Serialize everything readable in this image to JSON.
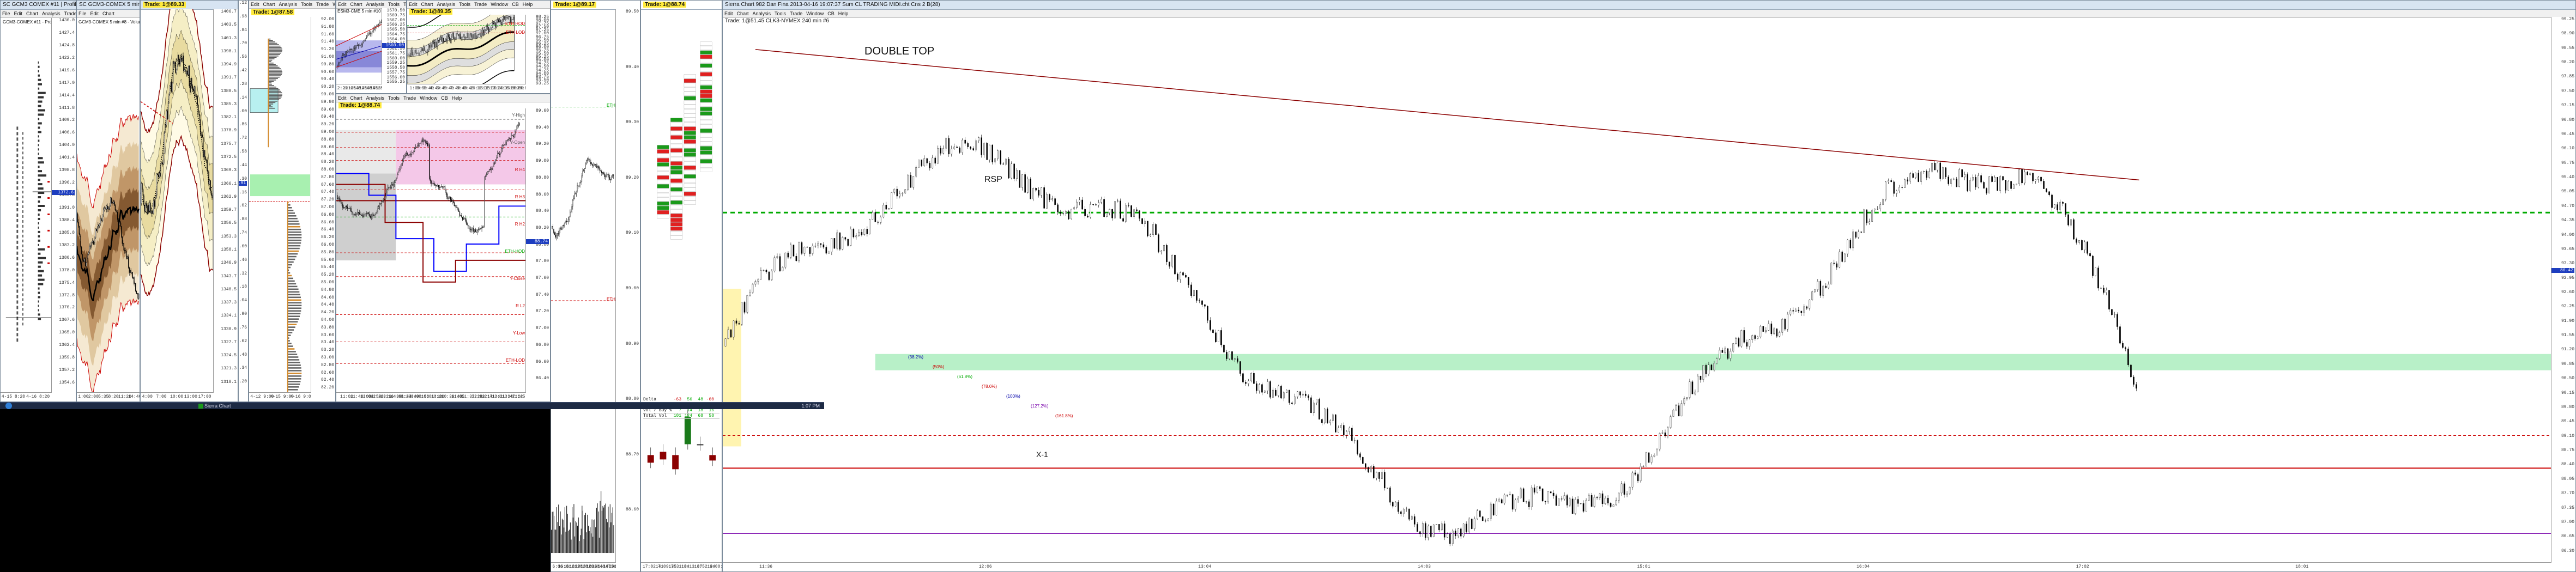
{
  "taskbar": {
    "task": "Sierra Chart",
    "clock": "1:07 PM"
  },
  "windows": {
    "w1": {
      "title": "SC GCM3 COMEX #11 | Profile Period: 1 Days, TPOs: 0.3 x 30 #",
      "menu": [
        "File",
        "Edit",
        "Chart",
        "Analysis",
        "Trade",
        "Window",
        "CB",
        "Help"
      ],
      "inner_title": "GCM3-COMEX  #11 - Profile Period: 1 Days",
      "axis": [
        "1430.0",
        "1427.4",
        "1424.8",
        "1422.2",
        "1419.6",
        "1417.0",
        "1414.4",
        "1411.8",
        "1409.2",
        "1406.6",
        "1404.0",
        "1401.4",
        "1398.8",
        "1396.2",
        "1393.6",
        "1391.0",
        "1388.4",
        "1385.8",
        "1383.2",
        "1380.6",
        "1378.0",
        "1375.4",
        "1372.8",
        "1370.2",
        "1367.6",
        "1365.0",
        "1362.4",
        "1359.8",
        "1357.2",
        "1354.6"
      ],
      "bottom": [
        "4-15  8:20",
        "4-16  8:20"
      ],
      "last": "1372.6"
    },
    "w2": {
      "title": "SC GCM3-COMEX  5 min  #8  COMEX Gol...",
      "inner_title": "GCM3-COMEX  5 min  #8 - Volume Weighted Avg...",
      "bottom": [
        "1:00",
        "2:00",
        "5:35",
        "8:20",
        "11:20",
        "14:40"
      ]
    },
    "w3": {
      "trade": "Trade: 1@89.33",
      "axis": [
        "1406.7",
        "1403.5",
        "1401.3",
        "1398.1",
        "1394.9",
        "1391.7",
        "1388.5",
        "1385.3",
        "1382.1",
        "1378.9",
        "1375.7",
        "1372.5",
        "1369.3",
        "1366.1",
        "1362.9",
        "1359.7",
        "1356.5",
        "1353.3",
        "1350.1",
        "1346.9",
        "1343.7",
        "1340.5",
        "1337.3",
        "1334.1",
        "1330.9",
        "1327.7",
        "1324.5",
        "1321.3",
        "1318.1"
      ],
      "bottom": [
        "4:00",
        "7:00",
        "10:00",
        "13:00",
        "17:00"
      ]
    },
    "w4": {
      "axis": [
        "90.12",
        "89.98",
        "89.84",
        "89.70",
        "89.56",
        "89.42",
        "89.28",
        "89.14",
        "89.00",
        "88.86",
        "88.72",
        "88.58",
        "88.44",
        "88.30",
        "88.16",
        "88.02",
        "87.88",
        "87.74",
        "87.60",
        "87.46",
        "87.32",
        "87.18",
        "87.04",
        "86.90",
        "86.76",
        "86.62",
        "86.48",
        "86.34",
        "86.20"
      ],
      "bottom": [
        "4-16  6:00",
        "12:00",
        "18:00",
        "0:00",
        "6:00",
        "12:00",
        "15:30",
        "19:30"
      ],
      "last": "86.91"
    },
    "w5": {
      "menu": [
        "Edit",
        "Chart",
        "Analysis",
        "Tools",
        "Trade",
        "Window",
        "CB",
        "Help"
      ],
      "trade": "Trade: 1@87.58",
      "axis": [
        "92.00",
        "91.80",
        "91.60",
        "91.40",
        "91.20",
        "91.00",
        "90.80",
        "90.60",
        "90.40",
        "90.20",
        "90.00",
        "89.80",
        "89.60",
        "89.40",
        "89.20",
        "89.00",
        "88.80",
        "88.60",
        "88.40",
        "88.20",
        "88.00",
        "87.80",
        "87.60",
        "87.40",
        "87.20",
        "87.00",
        "86.80",
        "86.60",
        "86.40",
        "86.20",
        "86.00",
        "85.80",
        "85.60",
        "85.40",
        "85.20",
        "85.00",
        "84.80",
        "84.60",
        "84.40",
        "84.20",
        "84.00",
        "83.80",
        "83.60",
        "83.40",
        "83.20",
        "83.00",
        "82.80",
        "82.60",
        "82.40",
        "82.20"
      ],
      "bottom": [
        "4-12  9:00",
        "4-15  9:00",
        "4-16  9:00"
      ]
    },
    "w6": {
      "menu": [
        "Edit",
        "Chart",
        "Analysis",
        "Tools",
        "Trade",
        "Window",
        "CB",
        "Help"
      ],
      "inner_title": "ESM3-CME  5 min  #10  TPO Value Area Lines - P...",
      "axis": [
        "1570.50",
        "1569.75",
        "1567.00",
        "1566.25",
        "1565.50",
        "1564.75",
        "1564.00",
        "1563.25",
        "1562.50",
        "1561.75",
        "1560.00",
        "1559.25",
        "1558.50",
        "1557.75",
        "1556.00",
        "1555.25"
      ],
      "last": "1560.00",
      "bottom": [
        "2:25",
        "12:05",
        "12:45",
        "13:25",
        "14:05",
        "14:45",
        "15:25",
        "16:05"
      ]
    },
    "w7": {
      "menu": [
        "Edit",
        "Chart",
        "Analysis",
        "Tools",
        "Trade",
        "Window",
        "CB",
        "Help"
      ],
      "trade": "Trade: 1@89.35",
      "axis": [
        "98.25",
        "98.00",
        "97.75",
        "97.50",
        "97.25",
        "97.00",
        "96.75",
        "96.50",
        "96.25",
        "96.00",
        "95.75",
        "95.50",
        "95.25",
        "95.00",
        "94.75",
        "94.50",
        "94.25",
        "94.00",
        "93.75",
        "93.50",
        "93.25"
      ],
      "labels": {
        "eth_hod": "ETH HOD",
        "eth_lod": "ETH LOD",
        "eth_vwap": "ETH VWAP"
      },
      "bottom": [
        "1:00",
        "3:00",
        "3:40",
        "4:40",
        "5:40",
        "6:40",
        "7:40",
        "8:40",
        "9:40",
        "10:15",
        "11:35",
        "12:35",
        "13:35",
        "14:35",
        "16:00",
        "18:00",
        "20:00"
      ]
    },
    "w8": {
      "menu": [
        "Edit",
        "Chart",
        "Analysis",
        "Tools",
        "Trade",
        "Window",
        "CB",
        "Help"
      ],
      "trade": "Trade: 1@88.74",
      "right_labels": [
        "Y-High",
        "Y-Open",
        "R H4",
        "R H3",
        "R H2",
        "ETH-HOD",
        "Y-Close",
        "R L2",
        "Y-Low",
        "ETH-LOD"
      ],
      "axis": [
        "89.60",
        "89.40",
        "89.20",
        "89.00",
        "88.80",
        "88.60",
        "88.40",
        "88.20",
        "88.00",
        "87.80",
        "87.60",
        "87.40",
        "87.20",
        "87.00",
        "86.80",
        "86.60",
        "86.40"
      ],
      "last": "88.74",
      "bottom": [
        "11:03",
        "11:40:08",
        "12:04:54",
        "12:28:29",
        "13:16:39",
        "14:01:44",
        "8:23:49",
        "9:08:53",
        "10:01:10",
        "10:20",
        "10:39:48",
        "11:05",
        "11:37:26",
        "12:03:17",
        "12:41:41",
        "13:21:34",
        "13:47:22",
        "11:45:03"
      ]
    },
    "w9": {
      "trade": "Trade: 1@89.17",
      "labels": {
        "eth_hod": "ETH HOD",
        "eth_lod": "ETH LOD"
      },
      "axis": [
        "89.50",
        "89.40",
        "89.30",
        "89.20",
        "89.10",
        "89.00",
        "88.90",
        "88.80",
        "88.70",
        "88.60"
      ],
      "bottom": [
        "6:06",
        "16:01",
        "16:11",
        "18:20",
        "18:28",
        "18:29",
        "16:30",
        "16:46",
        "16:47",
        "18:56",
        "19:01"
      ]
    },
    "w10": {
      "trade": "Trade: 1@88.74",
      "table_headers": [
        "Delta",
        "Cumulative",
        "Vol / Buy %",
        "Total Vol"
      ],
      "table_rows": [
        [
          "-63",
          "56",
          "48",
          "-60"
        ],
        [
          "1103",
          "1137",
          "1185",
          "1150"
        ],
        [
          "7",
          "14",
          "18",
          "16"
        ],
        [
          "101",
          "124",
          "68",
          "58"
        ]
      ],
      "bottom": [
        "17:02:41",
        "17:09:35",
        "17:31:34",
        "18:13:37",
        "18:52:34",
        "19:00:44"
      ]
    },
    "w11": {
      "title": "Sierra Chart 982 Dan Fina 2013-04-16  19:07:37  Sum  CL TRADING MIDI.cht  Cns 2 B(28)",
      "trade": "Trade: 1@51.45  CLK3-NYMEX  240 min  #6",
      "annotations": {
        "double_top": "DOUBLE TOP",
        "rsp": "RSP",
        "x1": "X-1"
      },
      "axis": [
        "99.25",
        "98.90",
        "98.55",
        "98.20",
        "97.85",
        "97.50",
        "97.15",
        "96.80",
        "96.45",
        "96.10",
        "95.75",
        "95.40",
        "95.05",
        "94.70",
        "94.35",
        "94.00",
        "93.65",
        "93.30",
        "92.95",
        "92.60",
        "92.25",
        "91.90",
        "91.55",
        "91.20",
        "90.85",
        "90.50",
        "90.15",
        "89.80",
        "89.45",
        "89.10",
        "88.75",
        "88.40",
        "88.05",
        "87.70",
        "87.35",
        "87.00",
        "86.65",
        "86.30"
      ],
      "last": "86.42",
      "fib_labels": [
        "(38.2%)",
        "(50%)",
        "(61.8%)",
        "(78.6%)",
        "(100%)",
        "(127.2%)",
        "(161.8%)"
      ],
      "bottom": [
        "11:36",
        "12:06",
        "13:04",
        "14:03",
        "15:01",
        "16:04",
        "17:02",
        "18:01"
      ]
    }
  },
  "colors": {
    "price_tag": "#1d3dbf",
    "trade_badge": "#ffea3b",
    "band_brown": "#8b5a2b",
    "band_tan": "#e8d8b8",
    "pink_zone": "#f4c8e8",
    "green_zone": "#a8f0b0",
    "cyan_zone": "#b8f0f0",
    "red_line": "#cc0000",
    "green_line": "#00aa00"
  }
}
